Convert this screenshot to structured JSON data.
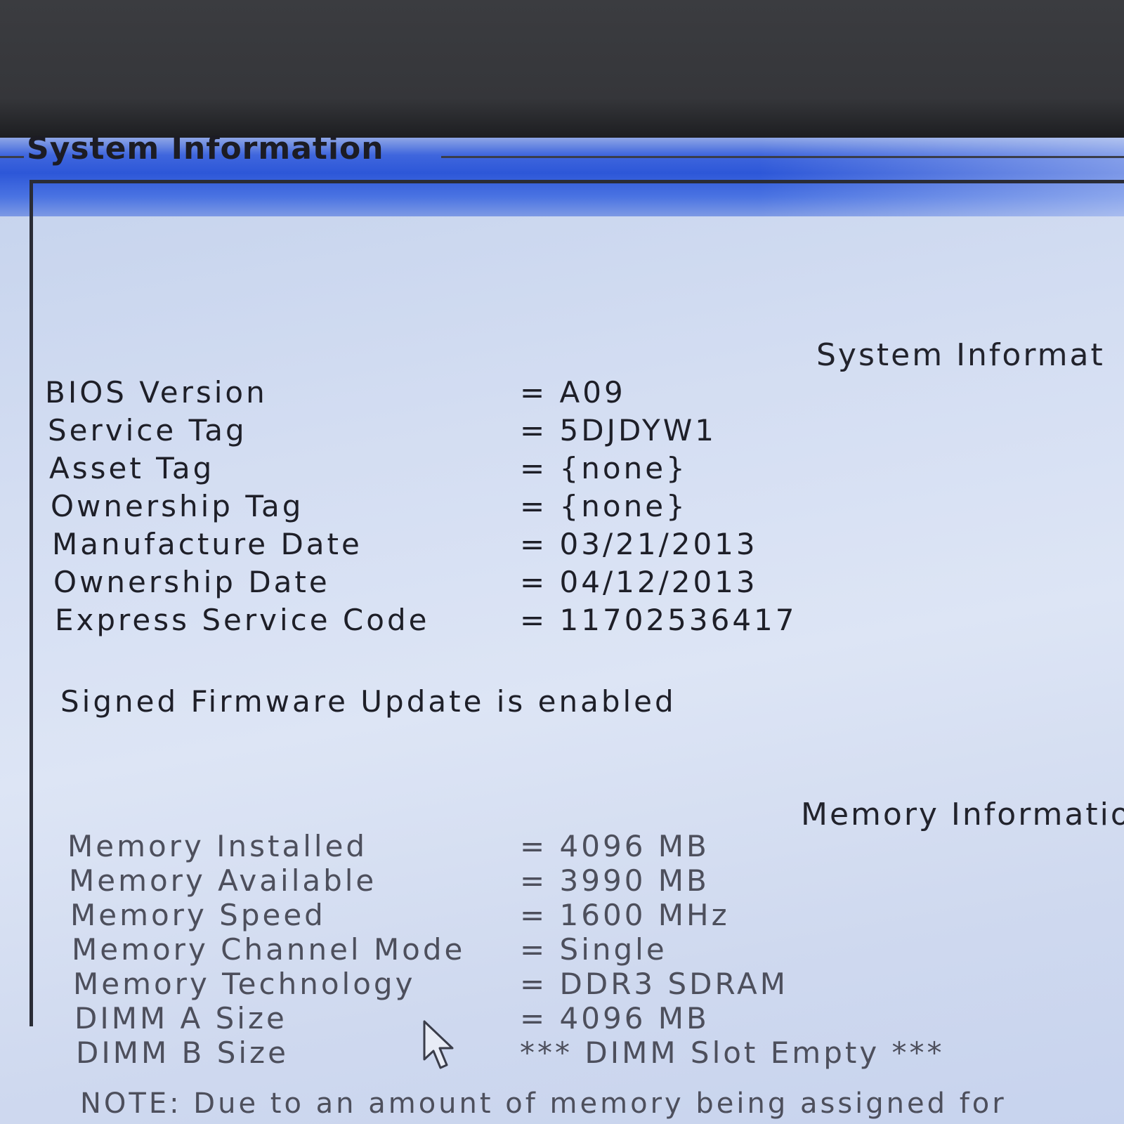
{
  "window": {
    "group_title": "System Information"
  },
  "system": {
    "section_title": "System Informat",
    "rows": [
      {
        "label": "BIOS Version",
        "value": "= A09"
      },
      {
        "label": "Service Tag",
        "value": "= 5DJDYW1"
      },
      {
        "label": "Asset Tag",
        "value": "= {none}"
      },
      {
        "label": "Ownership Tag",
        "value": "= {none}"
      },
      {
        "label": "Manufacture Date",
        "value": "= 03/21/2013"
      },
      {
        "label": "Ownership Date",
        "value": "= 04/12/2013"
      },
      {
        "label": "Express Service Code",
        "value": "= 11702536417"
      }
    ],
    "message": "Signed Firmware Update is enabled"
  },
  "memory": {
    "section_title": "Memory Informatio",
    "rows": [
      {
        "label": "Memory Installed",
        "value": "= 4096 MB"
      },
      {
        "label": "Memory Available",
        "value": "= 3990 MB"
      },
      {
        "label": "Memory Speed",
        "value": "= 1600 MHz"
      },
      {
        "label": "Memory Channel Mode",
        "value": "= Single"
      },
      {
        "label": "Memory Technology",
        "value": "= DDR3 SDRAM"
      },
      {
        "label": "DIMM A Size",
        "value": "= 4096 MB"
      },
      {
        "label": "DIMM B Size",
        "value": "*** DIMM Slot Empty ***"
      }
    ],
    "note": "NOTE: Due to an amount of memory being assigned for"
  },
  "icons": {
    "pointer": "mouse-pointer-icon"
  },
  "colors": {
    "title_bar": "#2d57d8",
    "background": "#d3ddf2",
    "text": "#1e1f28"
  }
}
